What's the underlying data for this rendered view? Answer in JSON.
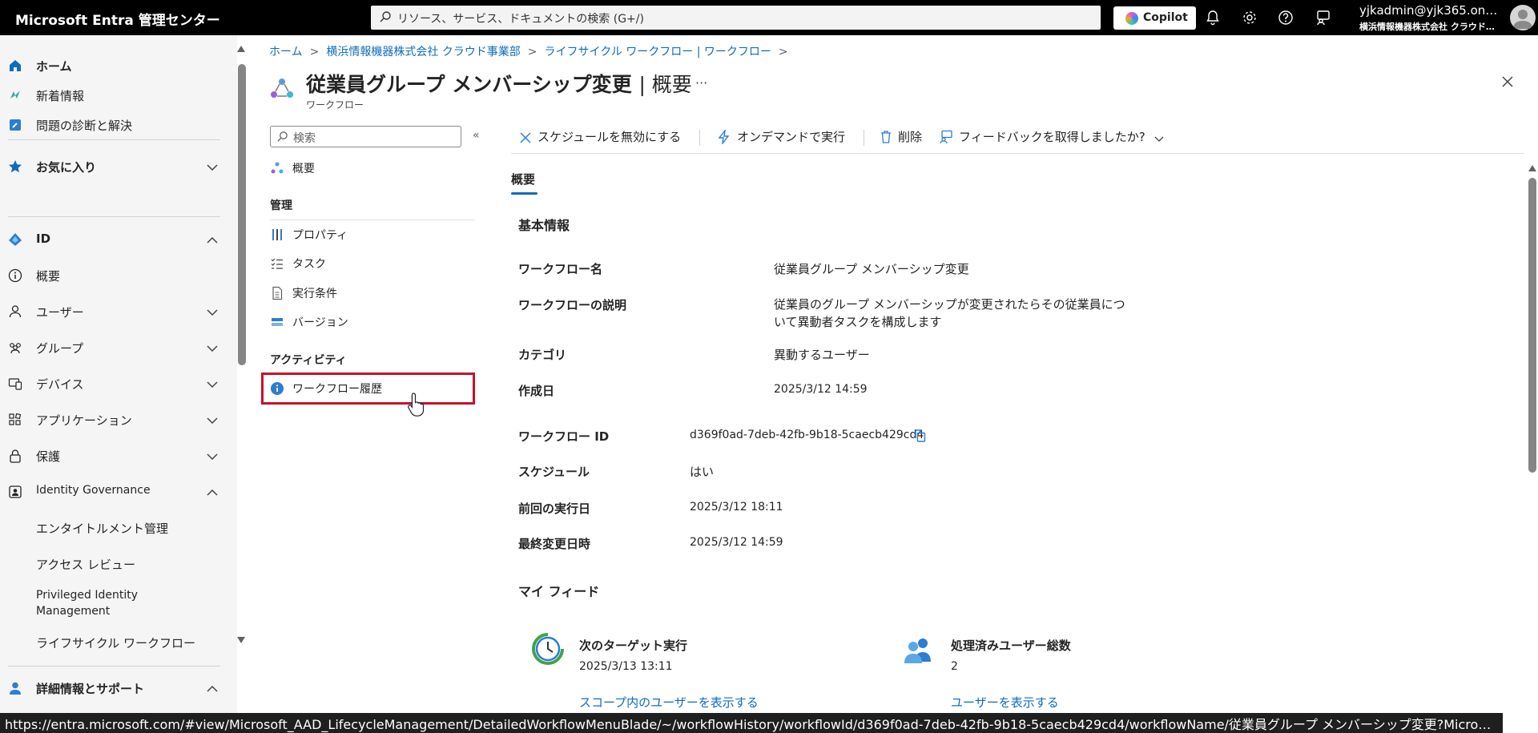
{
  "topbar": {
    "brand": "Microsoft Entra 管理センター",
    "search_placeholder": "リソース、サービス、ドキュメントの検索 (G+/)",
    "copilot_label": "Copilot",
    "user_name": "yjkadmin@yjk365.on…",
    "user_org": "横浜情報機器株式会社 クラウド…"
  },
  "leftnav": {
    "home": "ホーム",
    "whats_new": "新着情報",
    "diagnose": "問題の診断と解決",
    "favorites": "お気に入り",
    "id": "ID",
    "overview": "概要",
    "users": "ユーザー",
    "groups": "グループ",
    "devices": "デバイス",
    "applications": "アプリケーション",
    "protection": "保護",
    "identity_governance": "Identity Governance",
    "entitlement": "エンタイトルメント管理",
    "access_review": "アクセス レビュー",
    "pim_line1": "Privileged Identity",
    "pim_line2": "Management",
    "lifecycle": "ライフサイクル ワークフロー",
    "learn_support": "詳細情報とサポート"
  },
  "breadcrumb": [
    "ホーム",
    "横浜情報機器株式会社 クラウド事業部",
    "ライフサイクル ワークフロー | ワークフロー"
  ],
  "page": {
    "title": "従業員グループ メンバーシップ変更",
    "title_suffix": "| 概要",
    "subtitle": "ワークフロー",
    "more": "···"
  },
  "blade_menu": {
    "search_placeholder": "検索",
    "collapse": "«",
    "overview": "概要",
    "manage_header": "管理",
    "properties": "プロパティ",
    "tasks": "タスク",
    "conditions": "実行条件",
    "versions": "バージョン",
    "activity_header": "アクティビティ",
    "history": "ワークフロー履歴"
  },
  "toolbar": {
    "disable_schedule": "スケジュールを無効にする",
    "run_on_demand": "オンデマンドで実行",
    "delete": "削除",
    "feedback": "フィードバックを取得しましたか?"
  },
  "tab": "概要",
  "basic_info": {
    "title": "基本情報",
    "workflow_name_label": "ワークフロー名",
    "workflow_name": "従業員グループ メンバーシップ変更",
    "description_label": "ワークフローの説明",
    "description": "従業員のグループ メンバーシップが変更されたらその従業員について異動者タスクを構成します",
    "category_label": "カテゴリ",
    "category": "異動するユーザー",
    "created_label": "作成日",
    "created": "2025/3/12 14:59",
    "id_label": "ワークフロー ID",
    "id": "d369f0ad-7deb-42fb-9b18-5caecb429cd4",
    "schedule_label": "スケジュール",
    "schedule": "はい",
    "last_run_label": "前回の実行日",
    "last_run": "2025/3/12 18:11",
    "modified_label": "最終変更日時",
    "modified": "2025/3/12 14:59"
  },
  "my_feed": {
    "title": "マイ フィード",
    "next_run_title": "次のターゲット実行",
    "next_run": "2025/3/13 13:11",
    "next_run_link": "スコープ内のユーザーを表示する",
    "processed_title": "処理済みユーザー総数",
    "processed": "2",
    "processed_link": "ユーザーを表示する"
  },
  "statusbar": "https://entra.microsoft.com/#view/Microsoft_AAD_LifecycleManagement/DetailedWorkflowMenuBlade/~/workflowHistory/workflowId/d369f0ad-7deb-42fb-9b18-5caecb429cd4/workflowName/従業員グループ メンバーシップ変更?Micro…",
  "colors": {
    "accent": "#0f6cbd",
    "highlight": "#c8102e",
    "topbar": "#000000"
  }
}
